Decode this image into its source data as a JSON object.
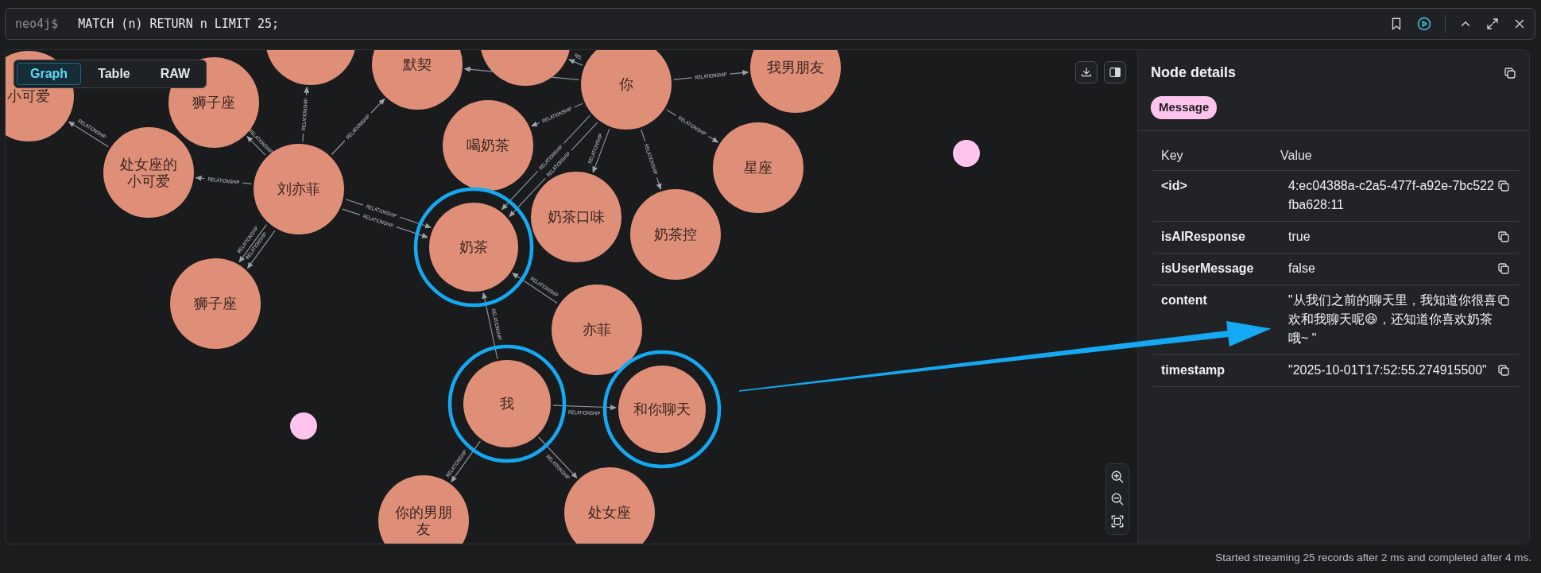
{
  "query_bar": {
    "prompt": "neo4j$",
    "query": "MATCH (n) RETURN n LIMIT 25;"
  },
  "view_tabs": [
    {
      "label": "Graph",
      "selected": true
    },
    {
      "label": "Table",
      "selected": false
    },
    {
      "label": "RAW",
      "selected": false
    }
  ],
  "graph": {
    "nodes": [
      {
        "caption": "小可爱",
        "color": "#df8f78",
        "highlighted": false
      },
      {
        "caption": "狮子座",
        "color": "#df8f78",
        "highlighted": false
      },
      {
        "color": "#df8f78",
        "highlighted": false
      },
      {
        "caption": "默契",
        "color": "#df8f78",
        "highlighted": false
      },
      {
        "color": "#df8f78",
        "highlighted": false
      },
      {
        "caption": "你",
        "color": "#df8f78",
        "highlighted": false
      },
      {
        "caption": "我男朋友",
        "color": "#df8f78",
        "highlighted": false
      },
      {
        "caption": "喝奶茶",
        "color": "#df8f78",
        "highlighted": false
      },
      {
        "color": "#ffc4ee",
        "highlighted": false
      },
      {
        "caption": "星座",
        "color": "#df8f78",
        "highlighted": false
      },
      {
        "caption": "处女座的小可爱",
        "color": "#df8f78",
        "highlighted": false
      },
      {
        "caption": "刘亦菲",
        "color": "#df8f78",
        "highlighted": false
      },
      {
        "caption": "奶茶口味",
        "color": "#df8f78",
        "highlighted": false
      },
      {
        "caption": "奶茶控",
        "color": "#df8f78",
        "highlighted": false
      },
      {
        "caption": "奶茶",
        "color": "#df8f78",
        "highlighted": true
      },
      {
        "caption": "狮子座",
        "color": "#df8f78",
        "highlighted": false
      },
      {
        "caption": "亦菲",
        "color": "#df8f78",
        "highlighted": false
      },
      {
        "caption": "我",
        "color": "#df8f78",
        "highlighted": true
      },
      {
        "caption": "和你聊天",
        "color": "#df8f78",
        "highlighted": true
      },
      {
        "color": "#ffc4ee",
        "highlighted": false
      },
      {
        "caption": "处女座",
        "color": "#df8f78",
        "highlighted": false
      },
      {
        "caption": "你的男朋友",
        "color": "#df8f78",
        "highlighted": false
      }
    ],
    "edges": [
      {
        "label": "RELATIONSHIP"
      },
      {
        "label": "RELATIONSHIP"
      },
      {
        "label": "RELATIONSHIP"
      },
      {
        "label": "RELATIONSHIP"
      },
      {
        "label": "RELATIONSHIP"
      },
      {
        "label": "RELATIONSHIP"
      },
      {
        "label": "RELATIONSHIP"
      },
      {
        "label": "RELATIONSHIP"
      },
      {
        "label": "RELATIONSHIP"
      },
      {
        "label": "REL"
      },
      {
        "label": "RELATIONSHIP"
      },
      {
        "label": "RELATIONSHIP"
      },
      {
        "label": "RELATIONSHIP"
      },
      {
        "label": "RELATIONSHIP"
      },
      {
        "label": "RELATIONSHIP"
      },
      {
        "label": "RELATIONSHIP"
      },
      {
        "label": "RELATIONSHIP"
      },
      {
        "label": "RELATIONSHIP"
      },
      {
        "label": "RELATIONSHIP"
      },
      {
        "label": "RELATIONSHIP"
      },
      {
        "label": "RELATIONSHIP"
      },
      {
        "label": "RELATIONSHIP"
      }
    ]
  },
  "node_details": {
    "title": "Node details",
    "label": "Message",
    "columns": [
      "Key",
      "Value"
    ],
    "properties": [
      {
        "key": "<id>",
        "value": "4:ec04388a-c2a5-477f-a92e-7bc522fba628:11"
      },
      {
        "key": "isAIResponse",
        "value": "true"
      },
      {
        "key": "isUserMessage",
        "value": "false"
      },
      {
        "key": "content",
        "value": "\"从我们之前的聊天里，我知道你很喜欢和我聊天呢😆，还知道你喜欢奶茶哦~ \""
      },
      {
        "key": "timestamp",
        "value": "\"2025-10-01T17:52:55.274915500\""
      }
    ]
  },
  "status_bar": "Started streaming 25 records after 2 ms and completed after 4 ms."
}
